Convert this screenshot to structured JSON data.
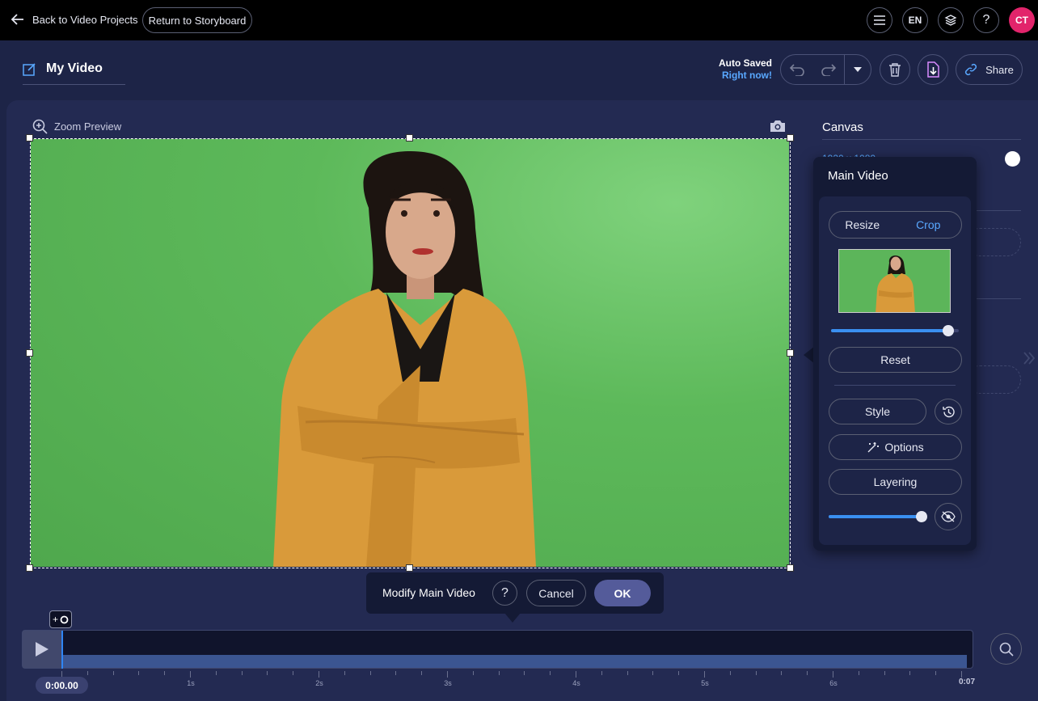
{
  "topbar": {
    "back_label": "Back to Video Projects",
    "storyboard_label": "Return to Storyboard",
    "language": "EN",
    "help": "?",
    "avatar_initials": "CT"
  },
  "project": {
    "title": "My Video",
    "autosave_line1": "Auto Saved",
    "autosave_line2": "Right now!",
    "share_label": "Share"
  },
  "preview": {
    "zoom_label": "Zoom Preview"
  },
  "canvas_panel": {
    "title": "Canvas",
    "dimension_partial": "1920 x 1080"
  },
  "main_video_panel": {
    "title": "Main Video",
    "tab_resize": "Resize",
    "tab_crop": "Crop",
    "active_tab": "Crop",
    "crop_slider_fraction": 0.92,
    "reset_label": "Reset",
    "style_label": "Style",
    "options_label": "Options",
    "layering_label": "Layering",
    "opacity_slider_fraction": 0.92
  },
  "modify_bar": {
    "label": "Modify Main Video",
    "help": "?",
    "cancel_label": "Cancel",
    "ok_label": "OK"
  },
  "timeline": {
    "add_marker_label": "+",
    "current_time": "0:00.00",
    "end_time": "0:07",
    "tick_labels": [
      "1s",
      "2s",
      "3s",
      "4s",
      "5s",
      "6s"
    ]
  },
  "colors": {
    "accent_blue": "#59a8ff",
    "avatar_pink": "#e2246b",
    "green_screen": "#5db95a",
    "jacket": "#d99a3a"
  }
}
